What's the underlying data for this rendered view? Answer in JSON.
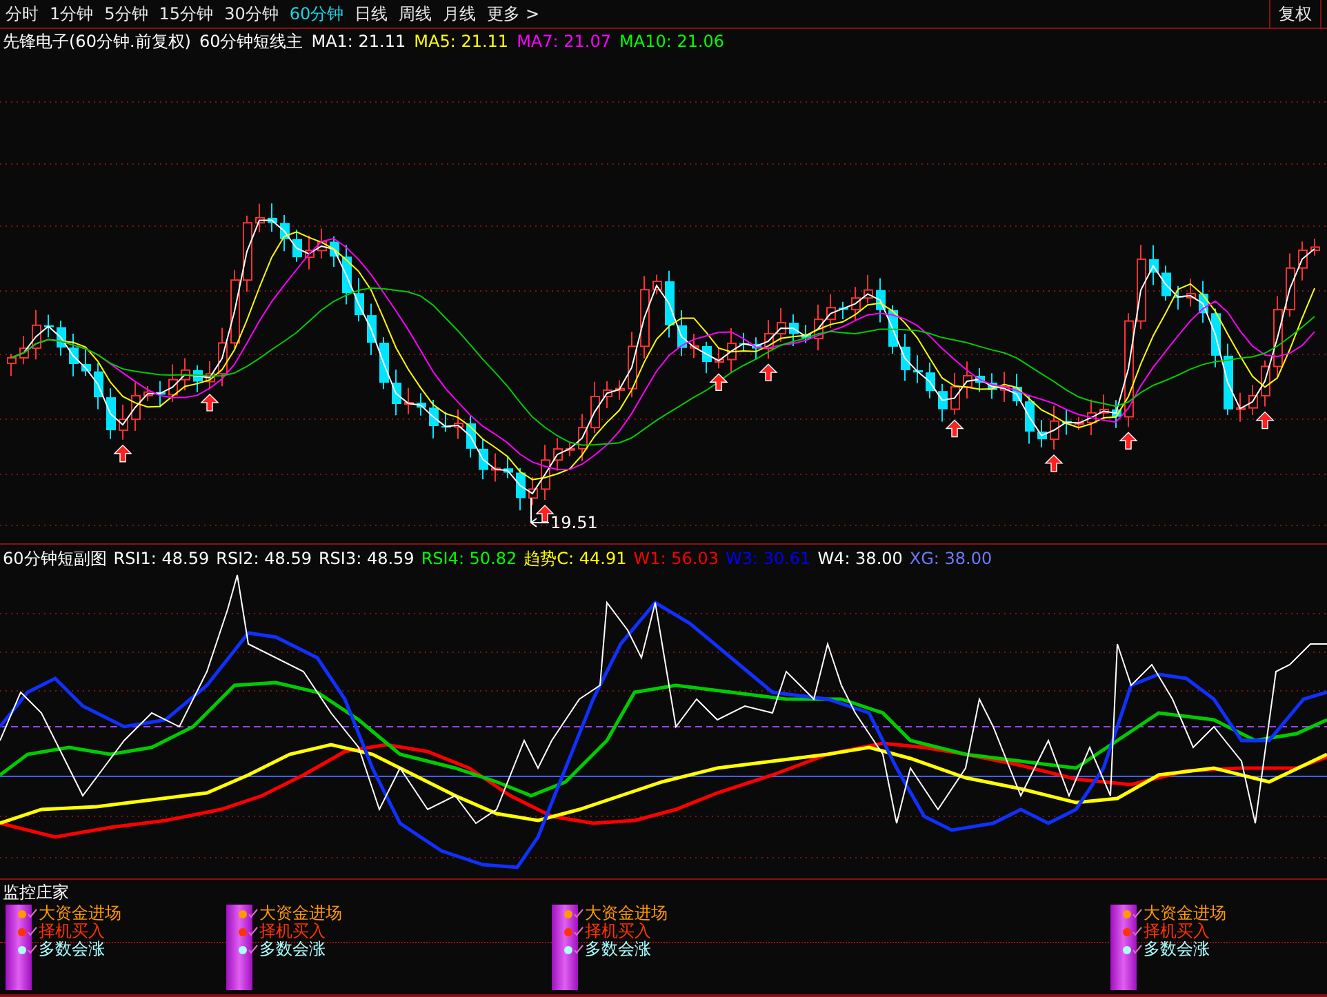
{
  "tabs": [
    {
      "label": "分时",
      "selected": false
    },
    {
      "label": "1分钟",
      "selected": false
    },
    {
      "label": "5分钟",
      "selected": false
    },
    {
      "label": "15分钟",
      "selected": false
    },
    {
      "label": "30分钟",
      "selected": false
    },
    {
      "label": "60分钟",
      "selected": true
    },
    {
      "label": "日线",
      "selected": false
    },
    {
      "label": "周线",
      "selected": false
    },
    {
      "label": "月线",
      "selected": false
    },
    {
      "label": "更多 >",
      "selected": false
    }
  ],
  "adjust_button": "复权",
  "main_chart": {
    "title": "先锋电子(60分钟.前复权)",
    "indicator": "60分钟短线主",
    "legend": [
      {
        "label": "MA1: 21.11",
        "color": "#ffffff"
      },
      {
        "label": "MA5: 21.11",
        "color": "#ffff00"
      },
      {
        "label": "MA7: 21.07",
        "color": "#ff00ff"
      },
      {
        "label": "MA10: 21.06",
        "color": "#00ff00"
      }
    ],
    "low_label": "19.51"
  },
  "sub_chart": {
    "title": "60分钟短副图",
    "legend": [
      {
        "label": "RSI1: 48.59",
        "color": "#ffffff"
      },
      {
        "label": "RSI2: 48.59",
        "color": "#ffffff"
      },
      {
        "label": "RSI3: 48.59",
        "color": "#ffffff"
      },
      {
        "label": "RSI4: 50.82",
        "color": "#00ff00"
      },
      {
        "label": "趋势C: 44.91",
        "color": "#ffff00"
      },
      {
        "label": "W1: 56.03",
        "color": "#ff0000"
      },
      {
        "label": "W3: 30.61",
        "color": "#0000ff"
      },
      {
        "label": "W4: 38.00",
        "color": "#ffffff"
      },
      {
        "label": "XG: 38.00",
        "color": "#6b7bff"
      }
    ]
  },
  "signal_panel": {
    "title": "监控庄家",
    "groups": [
      {
        "items": [
          {
            "label": "大资金进场",
            "color": "#ff9900"
          },
          {
            "label": "择机买入",
            "color": "#ff3300"
          },
          {
            "label": "多数会涨",
            "color": "#aaffff"
          }
        ]
      },
      {
        "items": [
          {
            "label": "大资金进场",
            "color": "#ff9900"
          },
          {
            "label": "择机买入",
            "color": "#ff3300"
          },
          {
            "label": "多数会涨",
            "color": "#aaffff"
          }
        ]
      },
      {
        "items": [
          {
            "label": "大资金进场",
            "color": "#ff9900"
          },
          {
            "label": "择机买入",
            "color": "#ff3300"
          },
          {
            "label": "多数会涨",
            "color": "#aaffff"
          }
        ]
      },
      {
        "items": [
          {
            "label": "大资金进场",
            "color": "#ff9900"
          },
          {
            "label": "择机买入",
            "color": "#ff3300"
          },
          {
            "label": "多数会涨",
            "color": "#aaffff"
          }
        ]
      }
    ]
  }
}
